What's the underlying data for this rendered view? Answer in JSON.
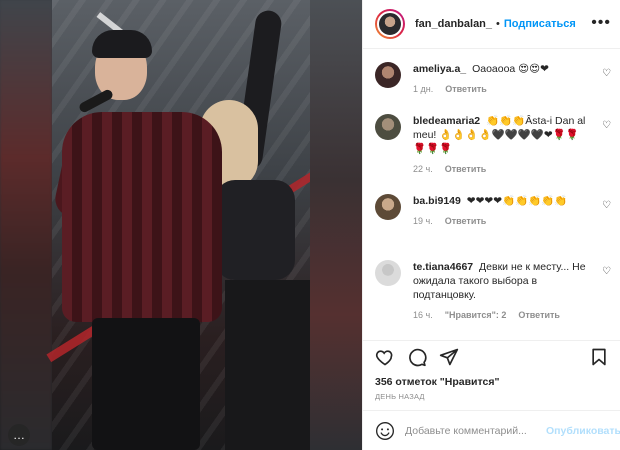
{
  "post": {
    "username": "fan_danbalan_",
    "separator": "•",
    "follow_label": "Подписаться",
    "more_icon": "ellipsis-icon",
    "photo_more_badge": "…"
  },
  "comments": [
    {
      "user": "ameliya.a_",
      "text": "Оаоаооа 😍😍❤",
      "time": "1 дн.",
      "likes": "",
      "reply_label": "Ответить",
      "avatar_color": "#5a3a3a"
    },
    {
      "user": "bledeamaria2",
      "text": "👏👏👏Âsta-i Dan al meu! 👌👌👌👌🖤🖤🖤🖤❤🌹🌹🌹🌹🌹",
      "time": "22 ч.",
      "likes": "",
      "reply_label": "Ответить",
      "avatar_color": "#6b6a5a"
    },
    {
      "user": "ba.bi9149",
      "text": "❤❤❤❤👏👏👏👏👏",
      "time": "19 ч.",
      "likes": "",
      "reply_label": "Ответить",
      "avatar_color": "#7a6048"
    },
    {
      "user": "te.tiana4667",
      "text": "Девки не к месту... Не ожидала такого выбора в подтанцовку.",
      "time": "16 ч.",
      "likes": "\"Нравится\": 2",
      "reply_label": "Ответить",
      "avatar_color": "#dbdbdb"
    }
  ],
  "actions": {
    "like_icon": "heart-icon",
    "comment_icon": "comment-icon",
    "share_icon": "share-icon",
    "save_icon": "bookmark-icon"
  },
  "likes_text": "356 отметок \"Нравится\"",
  "posted_text": "ДЕНЬ НАЗАД",
  "add_comment": {
    "placeholder": "Добавьте комментарий...",
    "post_label": "Опубликовать"
  },
  "colors": {
    "accent": "#0095f6",
    "post_disabled": "#b2dffc",
    "muted": "#8e8e8e",
    "text": "#262626"
  }
}
